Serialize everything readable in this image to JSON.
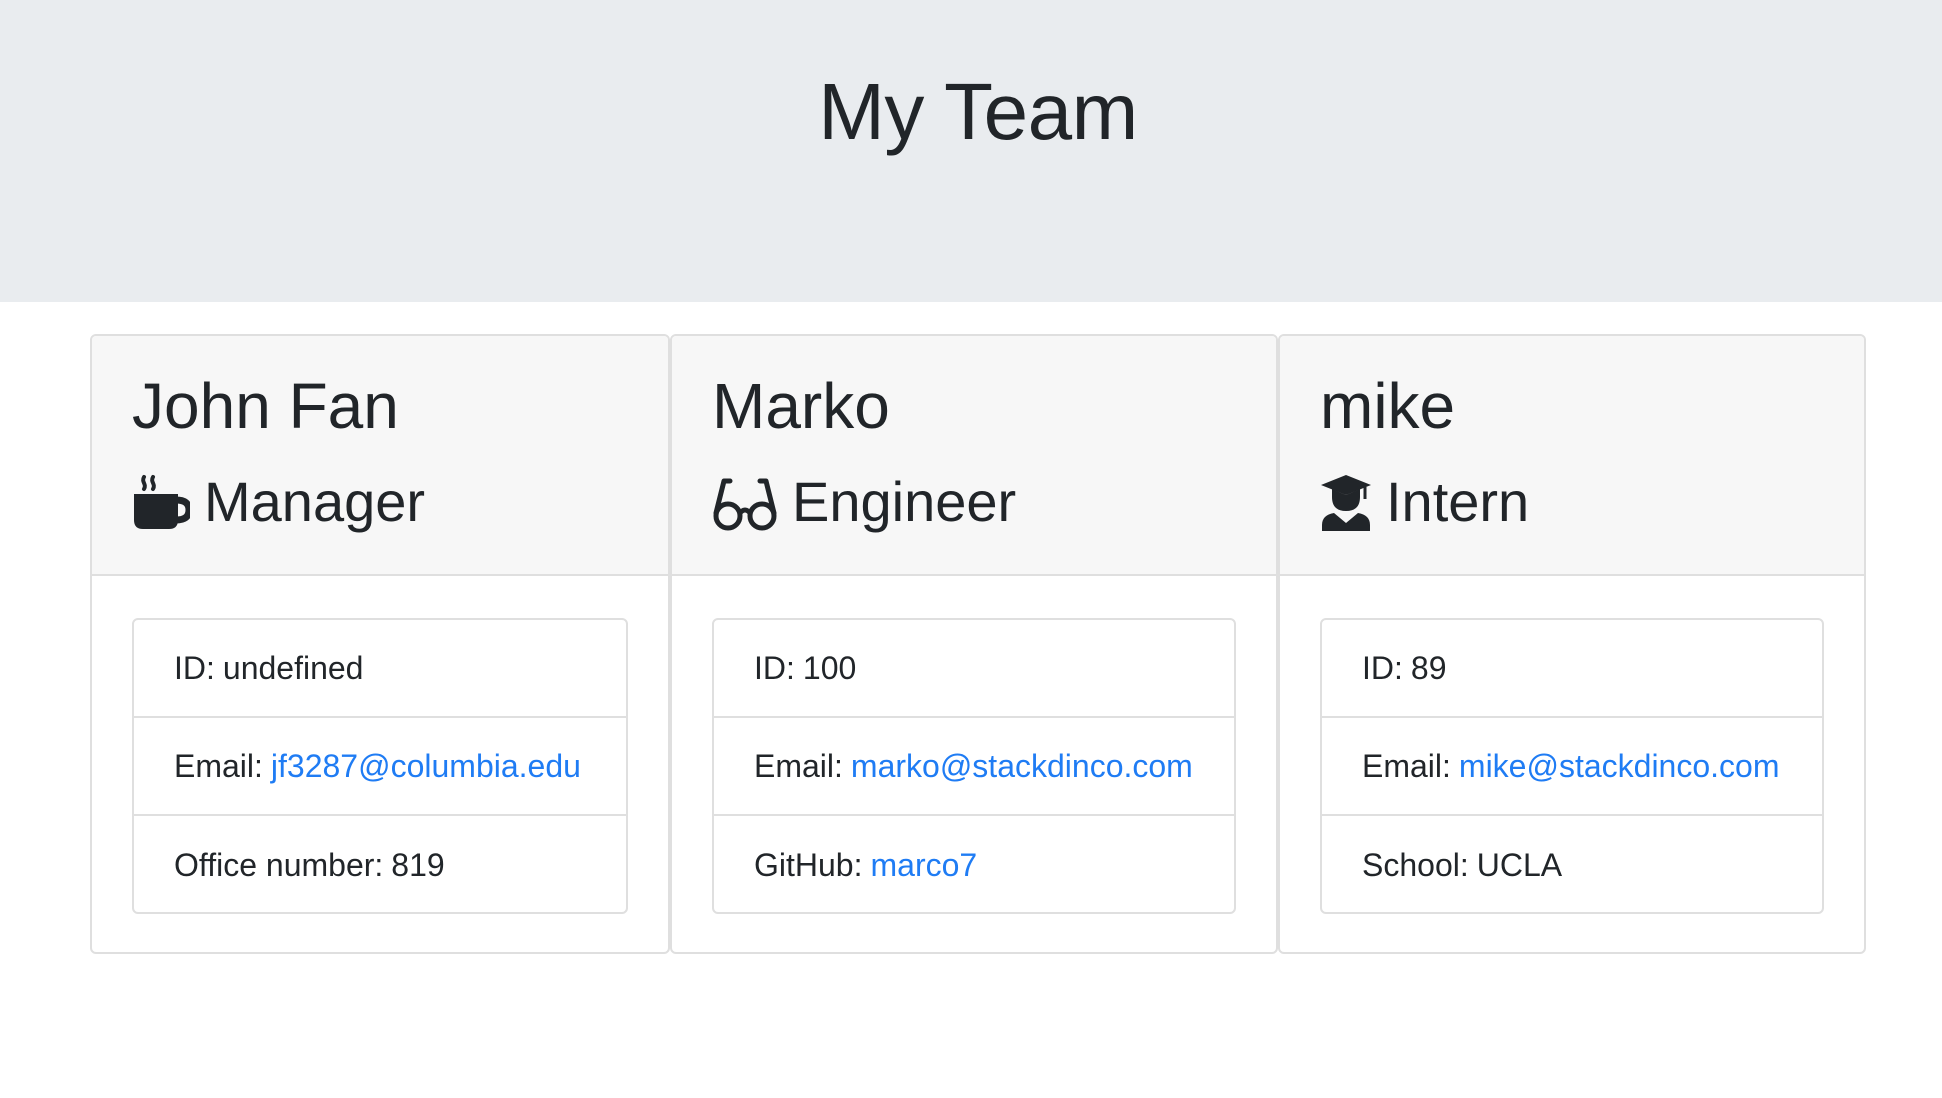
{
  "header": {
    "title": "My Team"
  },
  "employees": [
    {
      "name": "John Fan",
      "role": "Manager",
      "icon": "coffee-mug-icon",
      "details": [
        {
          "label": "ID:",
          "value": "undefined",
          "is_link": false
        },
        {
          "label": "Email:",
          "value": "jf3287@columbia.edu",
          "is_link": true
        },
        {
          "label": "Office number:",
          "value": "819",
          "is_link": false
        }
      ]
    },
    {
      "name": "Marko",
      "role": "Engineer",
      "icon": "glasses-icon",
      "details": [
        {
          "label": "ID:",
          "value": "100",
          "is_link": false
        },
        {
          "label": "Email:",
          "value": "marko@stackdinco.com",
          "is_link": true
        },
        {
          "label": "GitHub:",
          "value": "marco7",
          "is_link": true
        }
      ]
    },
    {
      "name": "mike",
      "role": "Intern",
      "icon": "graduate-icon",
      "details": [
        {
          "label": "ID:",
          "value": "89",
          "is_link": false
        },
        {
          "label": "Email:",
          "value": "mike@stackdinco.com",
          "is_link": true
        },
        {
          "label": "School:",
          "value": "UCLA",
          "is_link": false
        }
      ]
    }
  ],
  "colors": {
    "jumbotron_bg": "#e9ecef",
    "card_header_bg": "#f7f7f7",
    "border": "#dfdfdf",
    "link": "#1f7cf4",
    "text": "#212529"
  }
}
